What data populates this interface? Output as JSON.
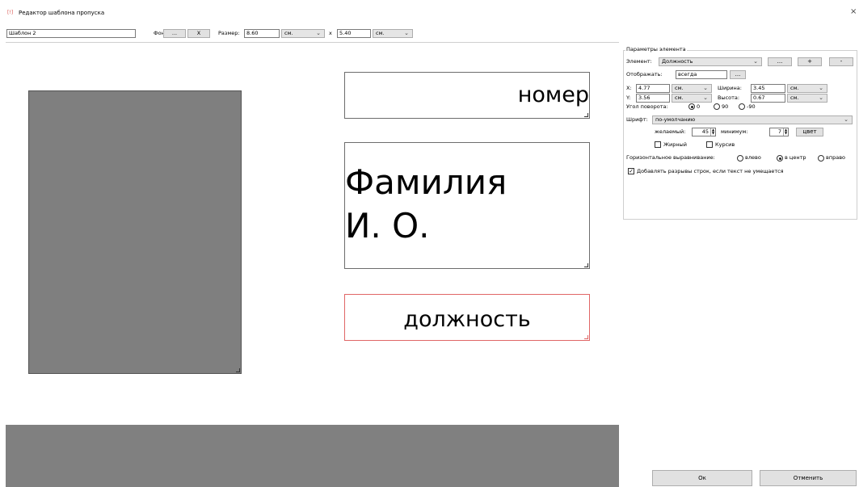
{
  "window": {
    "title": "Редактор шаблона пропуска",
    "icon": "[!]"
  },
  "toolbar": {
    "template_name": "Шаблон 2",
    "background_label": "Фон:",
    "background_browse": "...",
    "background_clear": "X",
    "size_label": "Размер:",
    "width_value": "8.60",
    "width_unit": "см.",
    "times": "x",
    "height_value": "5.40",
    "height_unit": "см."
  },
  "canvas": {
    "number_text": "номер",
    "name_text": "Фамилия И. О.",
    "position_text": "должность"
  },
  "params": {
    "legend": "Параметры элемента",
    "element_label": "Элемент:",
    "element_value": "Должность",
    "browse": "...",
    "add": "+",
    "remove": "-",
    "show_label": "Отображать:",
    "show_value": "всегда",
    "x_label": "X:",
    "x_value": "4.77",
    "x_unit": "см.",
    "width_label": "Ширина:",
    "width_value": "3.45",
    "width_unit": "см.",
    "y_label": "Y:",
    "y_value": "3.56",
    "y_unit": "см.",
    "height_label": "Высота:",
    "height_value": "0.67",
    "height_unit": "см.",
    "rotation_label": "Угол поворота:",
    "rot0": "0",
    "rot90": "90",
    "rotm90": "-90",
    "font_label": "Шрифт:",
    "font_value": "по-умолчанию",
    "desired_label": "желаемый:",
    "desired_value": "45",
    "min_label": "минимум:",
    "min_value": "7",
    "color_button": "цвет",
    "bold_label": "Жирный",
    "italic_label": "Курсив",
    "halign_label": "Горизонтальное выравнивание:",
    "left_label": "влево",
    "center_label": "в центр",
    "right_label": "вправо",
    "wrap_label": "Добавлять разрывы строк, если текст не умещается"
  },
  "footer": {
    "ok": "Ок",
    "cancel": "Отменить"
  }
}
